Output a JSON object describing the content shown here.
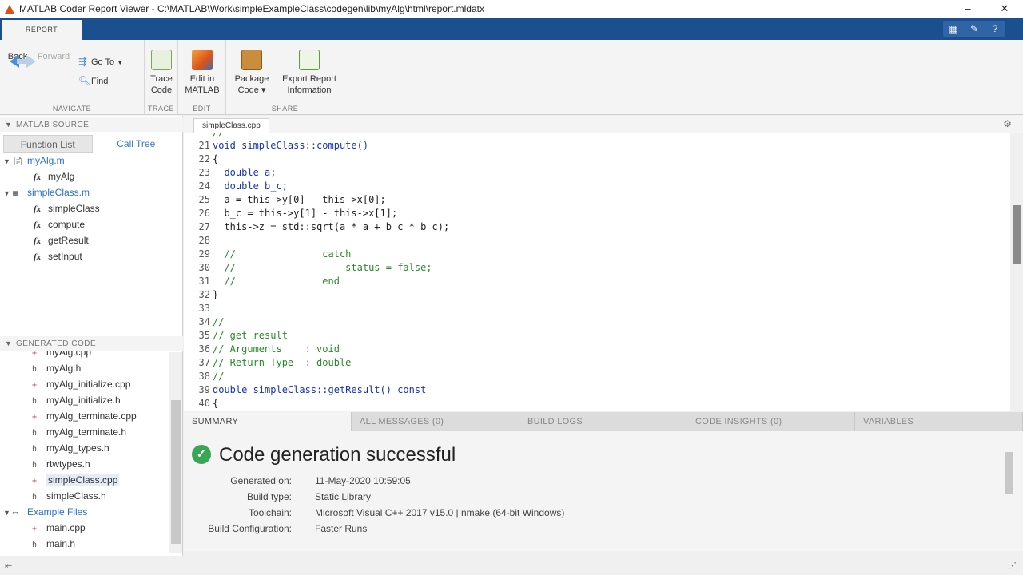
{
  "window": {
    "title": "MATLAB Coder Report Viewer - C:\\MATLAB\\Work\\simpleExampleClass\\codegen\\lib\\myAlg\\html\\report.mldatx",
    "minimize": "–",
    "restore": "▭",
    "close": "✕"
  },
  "ribbon": {
    "tab": "REPORT",
    "sections": {
      "navigate": {
        "label": "NAVIGATE",
        "back": "Back",
        "forward": "Forward",
        "goto": "Go To",
        "find": "Find"
      },
      "trace": {
        "label": "TRACE",
        "trace_code": [
          "Trace",
          "Code"
        ]
      },
      "edit": {
        "label": "EDIT",
        "edit_in_matlab": [
          "Edit in",
          "MATLAB"
        ]
      },
      "share": {
        "label": "SHARE",
        "package_code": [
          "Package",
          "Code ▾"
        ],
        "export_report": [
          "Export Report",
          "Information"
        ]
      }
    }
  },
  "left_panel": {
    "matlab_source_header": "MATLAB SOURCE",
    "subtabs": [
      "Function List",
      "Call Tree"
    ],
    "tree": [
      {
        "label": "myAlg.m",
        "type": "m-file",
        "link": true
      },
      {
        "label": "myAlg",
        "type": "function"
      },
      {
        "label": "simpleClass.m",
        "type": "m-file",
        "link": true
      },
      {
        "label": "simpleClass",
        "type": "function"
      },
      {
        "label": "compute",
        "type": "function"
      },
      {
        "label": "getResult",
        "type": "function"
      },
      {
        "label": "setInput",
        "type": "function"
      }
    ],
    "generated_code_header": "GENERATED CODE",
    "files": [
      {
        "label": "myAlg.cpp",
        "kind": "cpp"
      },
      {
        "label": "myAlg.h",
        "kind": "h"
      },
      {
        "label": "myAlg_initialize.cpp",
        "kind": "cpp"
      },
      {
        "label": "myAlg_initialize.h",
        "kind": "h"
      },
      {
        "label": "myAlg_terminate.cpp",
        "kind": "cpp"
      },
      {
        "label": "myAlg_terminate.h",
        "kind": "h"
      },
      {
        "label": "myAlg_types.h",
        "kind": "h"
      },
      {
        "label": "rtwtypes.h",
        "kind": "h"
      },
      {
        "label": "simpleClass.cpp",
        "kind": "cpp",
        "selected": true
      },
      {
        "label": "simpleClass.h",
        "kind": "h"
      }
    ],
    "example_files_label": "Example Files",
    "example_files": [
      {
        "label": "main.cpp",
        "kind": "cpp"
      },
      {
        "label": "main.h",
        "kind": "h"
      }
    ]
  },
  "editor": {
    "tab": "simpleClass.cpp",
    "lines": [
      {
        "n": "",
        "code": "//"
      },
      {
        "n": "21",
        "code": "void simpleClass::compute()"
      },
      {
        "n": "22",
        "code": "{"
      },
      {
        "n": "23",
        "code": "  double a;"
      },
      {
        "n": "24",
        "code": "  double b_c;"
      },
      {
        "n": "25",
        "code": "  a = this->y[0] - this->x[0];"
      },
      {
        "n": "26",
        "code": "  b_c = this->y[1] - this->x[1];"
      },
      {
        "n": "27",
        "code": "  this->z = std::sqrt(a * a + b_c * b_c);"
      },
      {
        "n": "28",
        "code": ""
      },
      {
        "n": "29",
        "code": "  //               catch"
      },
      {
        "n": "30",
        "code": "  //                   status = false;"
      },
      {
        "n": "31",
        "code": "  //               end"
      },
      {
        "n": "32",
        "code": "}"
      },
      {
        "n": "33",
        "code": ""
      },
      {
        "n": "34",
        "code": "//"
      },
      {
        "n": "35",
        "code": "// get result"
      },
      {
        "n": "36",
        "code": "// Arguments    : void"
      },
      {
        "n": "37",
        "code": "// Return Type  : double"
      },
      {
        "n": "38",
        "code": "//"
      },
      {
        "n": "39",
        "code": "double simpleClass::getResult() const"
      },
      {
        "n": "40",
        "code": "{"
      }
    ]
  },
  "bottom_tabs": [
    "SUMMARY",
    "ALL MESSAGES (0)",
    "BUILD LOGS",
    "CODE INSIGHTS (0)",
    "VARIABLES"
  ],
  "summary": {
    "heading": "Code generation successful",
    "rows": [
      {
        "k": "Generated on:",
        "v": "11-May-2020 10:59:05"
      },
      {
        "k": "Build type:",
        "v": "Static Library"
      },
      {
        "k": "Toolchain:",
        "v": "Microsoft Visual C++ 2017 v15.0 | nmake (64-bit Windows)"
      },
      {
        "k": "Build Configuration:",
        "v": "Faster Runs"
      }
    ]
  }
}
